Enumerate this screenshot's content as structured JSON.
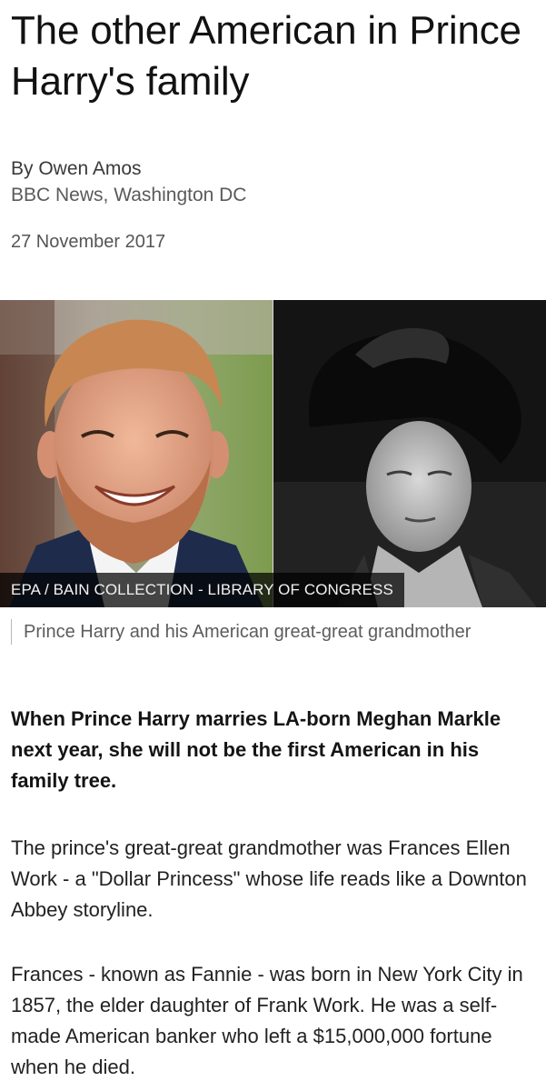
{
  "article": {
    "headline": "The other American in Prince Harry's family",
    "author": "By Owen Amos",
    "location": "BBC News, Washington DC",
    "date": "27 November 2017",
    "image": {
      "credit": "EPA / BAIN COLLECTION - LIBRARY OF CONGRESS",
      "caption": "Prince Harry and his American great-great grandmother"
    },
    "intro": "When Prince Harry marries LA-born Meghan Markle next year, she will not be the first American in his family tree.",
    "paragraphs": [
      "The prince's great-great grandmother was Frances Ellen Work - a \"Dollar Princess\" whose life reads like a Downton Abbey storyline.",
      "Frances - known as Fannie - was born in New York City in 1857, the elder daughter of Frank Work. He was a self-made American banker who left a $15,000,000 fortune when he died."
    ]
  }
}
